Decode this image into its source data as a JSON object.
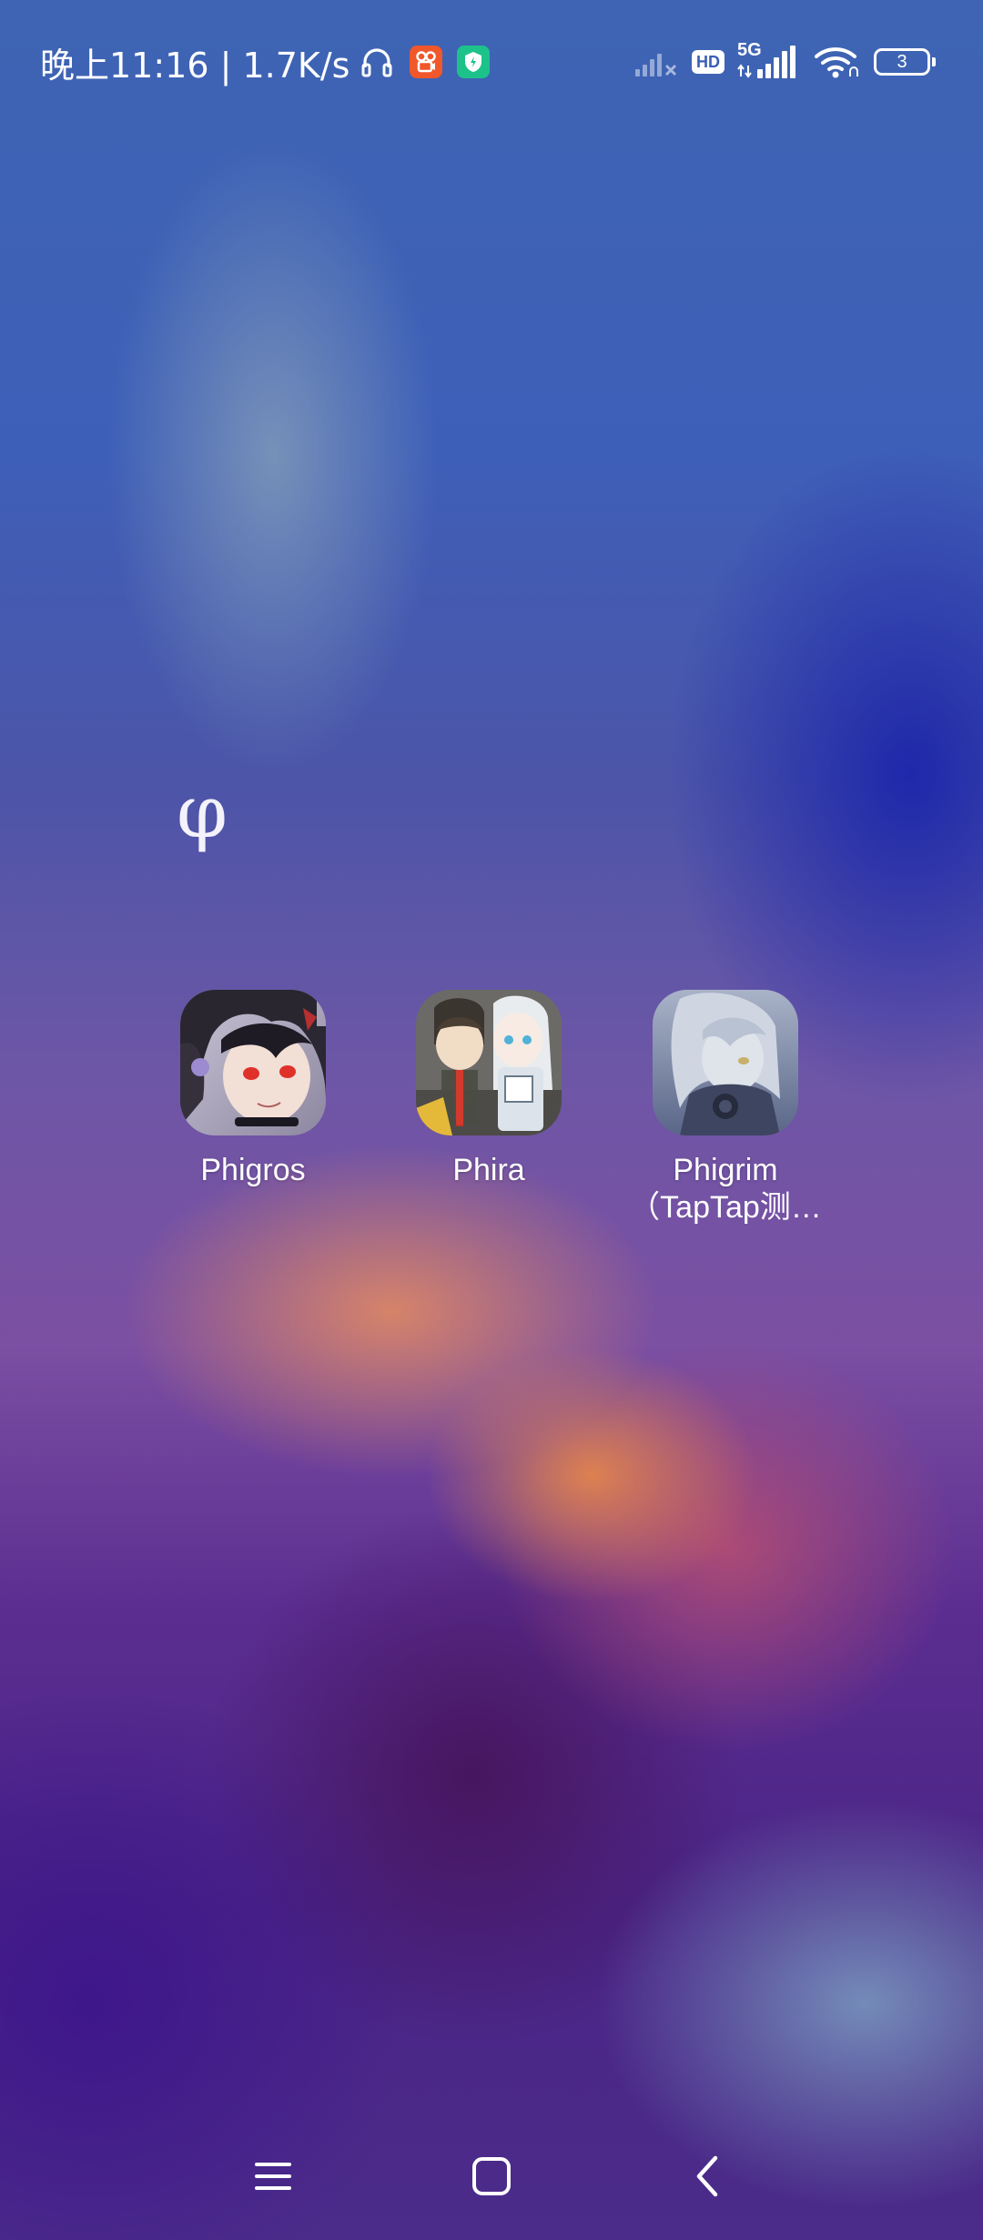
{
  "status_bar": {
    "time_speed": "晚上11:16 | 1.7K/s",
    "hd_label": "HD",
    "network_label": "5G",
    "battery_level": "3",
    "icons": [
      "headset-icon",
      "kuaishou-app-icon",
      "security-shield-icon",
      "signal-weak-icon",
      "hd-icon",
      "5g-signal-icon",
      "wifi-icon",
      "battery-icon"
    ]
  },
  "folder": {
    "title": "φ",
    "apps": [
      {
        "label": "Phigros"
      },
      {
        "label": "Phira"
      },
      {
        "label": "Phigrim",
        "label_line2": "（TapTap测…"
      }
    ]
  },
  "nav_bar": {
    "icons": [
      "menu-icon",
      "home-icon",
      "back-icon"
    ]
  },
  "colors": {
    "battery_text": "#ffffff",
    "kuaishou_orange": "#f0572a",
    "shield_green": "#1dc28b"
  }
}
